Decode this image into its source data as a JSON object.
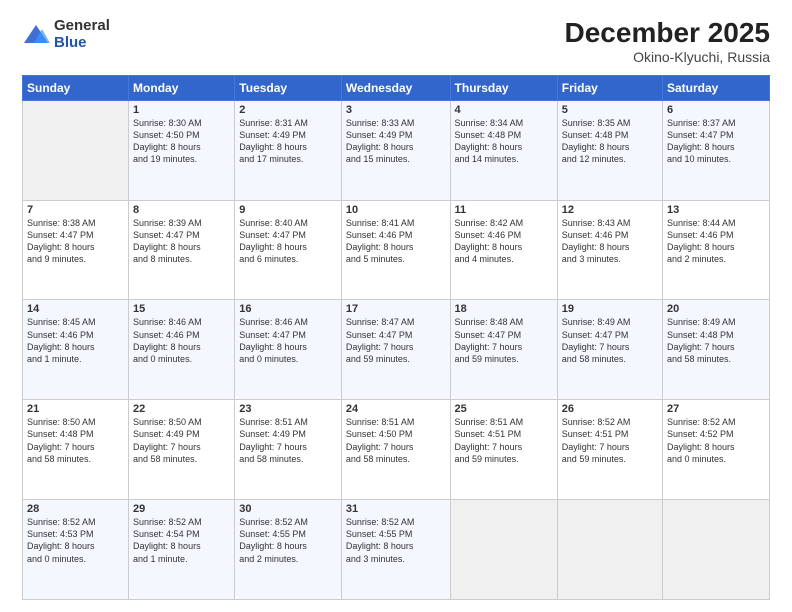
{
  "logo": {
    "general": "General",
    "blue": "Blue"
  },
  "header": {
    "month": "December 2025",
    "location": "Okino-Klyuchi, Russia"
  },
  "weekdays": [
    "Sunday",
    "Monday",
    "Tuesday",
    "Wednesday",
    "Thursday",
    "Friday",
    "Saturday"
  ],
  "weeks": [
    [
      {
        "day": "",
        "content": ""
      },
      {
        "day": "1",
        "content": "Sunrise: 8:30 AM\nSunset: 4:50 PM\nDaylight: 8 hours\nand 19 minutes."
      },
      {
        "day": "2",
        "content": "Sunrise: 8:31 AM\nSunset: 4:49 PM\nDaylight: 8 hours\nand 17 minutes."
      },
      {
        "day": "3",
        "content": "Sunrise: 8:33 AM\nSunset: 4:49 PM\nDaylight: 8 hours\nand 15 minutes."
      },
      {
        "day": "4",
        "content": "Sunrise: 8:34 AM\nSunset: 4:48 PM\nDaylight: 8 hours\nand 14 minutes."
      },
      {
        "day": "5",
        "content": "Sunrise: 8:35 AM\nSunset: 4:48 PM\nDaylight: 8 hours\nand 12 minutes."
      },
      {
        "day": "6",
        "content": "Sunrise: 8:37 AM\nSunset: 4:47 PM\nDaylight: 8 hours\nand 10 minutes."
      }
    ],
    [
      {
        "day": "7",
        "content": "Sunrise: 8:38 AM\nSunset: 4:47 PM\nDaylight: 8 hours\nand 9 minutes."
      },
      {
        "day": "8",
        "content": "Sunrise: 8:39 AM\nSunset: 4:47 PM\nDaylight: 8 hours\nand 8 minutes."
      },
      {
        "day": "9",
        "content": "Sunrise: 8:40 AM\nSunset: 4:47 PM\nDaylight: 8 hours\nand 6 minutes."
      },
      {
        "day": "10",
        "content": "Sunrise: 8:41 AM\nSunset: 4:46 PM\nDaylight: 8 hours\nand 5 minutes."
      },
      {
        "day": "11",
        "content": "Sunrise: 8:42 AM\nSunset: 4:46 PM\nDaylight: 8 hours\nand 4 minutes."
      },
      {
        "day": "12",
        "content": "Sunrise: 8:43 AM\nSunset: 4:46 PM\nDaylight: 8 hours\nand 3 minutes."
      },
      {
        "day": "13",
        "content": "Sunrise: 8:44 AM\nSunset: 4:46 PM\nDaylight: 8 hours\nand 2 minutes."
      }
    ],
    [
      {
        "day": "14",
        "content": "Sunrise: 8:45 AM\nSunset: 4:46 PM\nDaylight: 8 hours\nand 1 minute."
      },
      {
        "day": "15",
        "content": "Sunrise: 8:46 AM\nSunset: 4:46 PM\nDaylight: 8 hours\nand 0 minutes."
      },
      {
        "day": "16",
        "content": "Sunrise: 8:46 AM\nSunset: 4:47 PM\nDaylight: 8 hours\nand 0 minutes."
      },
      {
        "day": "17",
        "content": "Sunrise: 8:47 AM\nSunset: 4:47 PM\nDaylight: 7 hours\nand 59 minutes."
      },
      {
        "day": "18",
        "content": "Sunrise: 8:48 AM\nSunset: 4:47 PM\nDaylight: 7 hours\nand 59 minutes."
      },
      {
        "day": "19",
        "content": "Sunrise: 8:49 AM\nSunset: 4:47 PM\nDaylight: 7 hours\nand 58 minutes."
      },
      {
        "day": "20",
        "content": "Sunrise: 8:49 AM\nSunset: 4:48 PM\nDaylight: 7 hours\nand 58 minutes."
      }
    ],
    [
      {
        "day": "21",
        "content": "Sunrise: 8:50 AM\nSunset: 4:48 PM\nDaylight: 7 hours\nand 58 minutes."
      },
      {
        "day": "22",
        "content": "Sunrise: 8:50 AM\nSunset: 4:49 PM\nDaylight: 7 hours\nand 58 minutes."
      },
      {
        "day": "23",
        "content": "Sunrise: 8:51 AM\nSunset: 4:49 PM\nDaylight: 7 hours\nand 58 minutes."
      },
      {
        "day": "24",
        "content": "Sunrise: 8:51 AM\nSunset: 4:50 PM\nDaylight: 7 hours\nand 58 minutes."
      },
      {
        "day": "25",
        "content": "Sunrise: 8:51 AM\nSunset: 4:51 PM\nDaylight: 7 hours\nand 59 minutes."
      },
      {
        "day": "26",
        "content": "Sunrise: 8:52 AM\nSunset: 4:51 PM\nDaylight: 7 hours\nand 59 minutes."
      },
      {
        "day": "27",
        "content": "Sunrise: 8:52 AM\nSunset: 4:52 PM\nDaylight: 8 hours\nand 0 minutes."
      }
    ],
    [
      {
        "day": "28",
        "content": "Sunrise: 8:52 AM\nSunset: 4:53 PM\nDaylight: 8 hours\nand 0 minutes."
      },
      {
        "day": "29",
        "content": "Sunrise: 8:52 AM\nSunset: 4:54 PM\nDaylight: 8 hours\nand 1 minute."
      },
      {
        "day": "30",
        "content": "Sunrise: 8:52 AM\nSunset: 4:55 PM\nDaylight: 8 hours\nand 2 minutes."
      },
      {
        "day": "31",
        "content": "Sunrise: 8:52 AM\nSunset: 4:55 PM\nDaylight: 8 hours\nand 3 minutes."
      },
      {
        "day": "",
        "content": ""
      },
      {
        "day": "",
        "content": ""
      },
      {
        "day": "",
        "content": ""
      }
    ]
  ]
}
